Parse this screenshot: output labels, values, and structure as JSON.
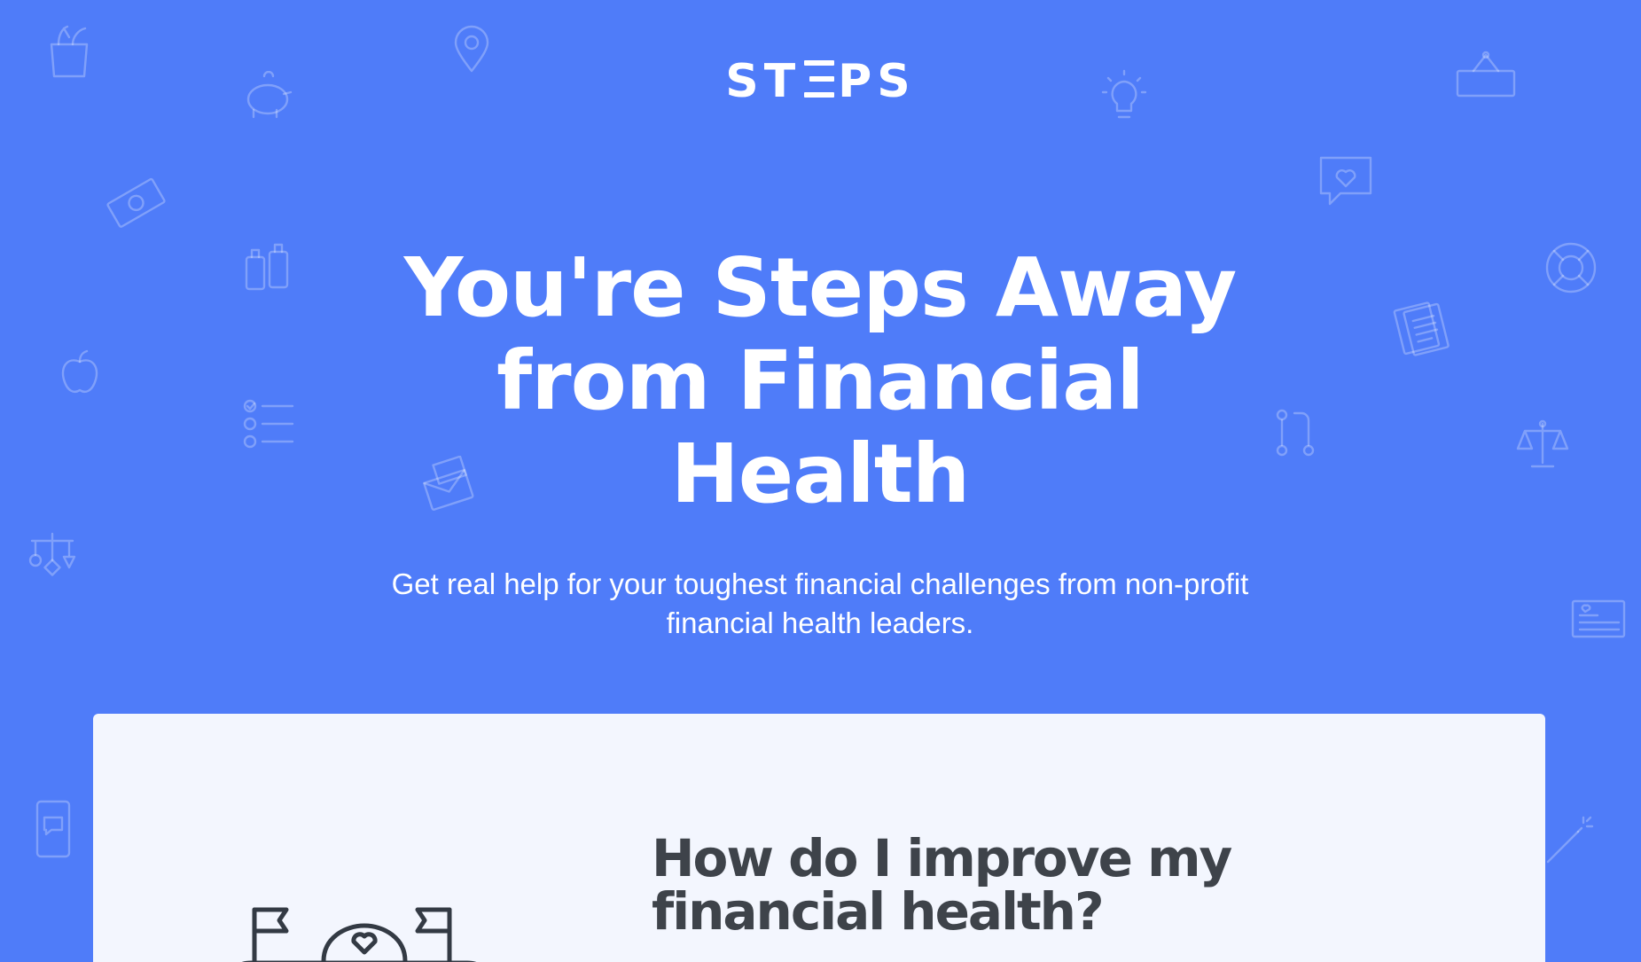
{
  "brand": {
    "logo_text_left": "ST",
    "logo_text_right": "PS"
  },
  "hero": {
    "title": "You're Steps Away from Financial Health",
    "subtitle": "Get real help for your toughest financial challenges from non-profit financial health leaders."
  },
  "card": {
    "heading": "How do I improve my financial health?"
  },
  "background_icons": [
    "grocery-bag-icon",
    "location-pin-icon",
    "piggy-bank-icon",
    "lightbulb-icon",
    "open-sign-icon",
    "money-bill-icon",
    "chat-heart-icon",
    "baby-bottles-icon",
    "life-ring-icon",
    "documents-icon",
    "apple-icon",
    "checklist-icon",
    "path-steps-icon",
    "scales-icon",
    "envelope-money-icon",
    "mobile-chat-icon",
    "baby-mobile-icon",
    "credit-card-icon",
    "magic-wand-icon"
  ],
  "colors": {
    "background": "#4f7cf9",
    "card_background": "#f3f6fe",
    "heading_text": "#3e434a",
    "hero_text": "#ffffff"
  }
}
